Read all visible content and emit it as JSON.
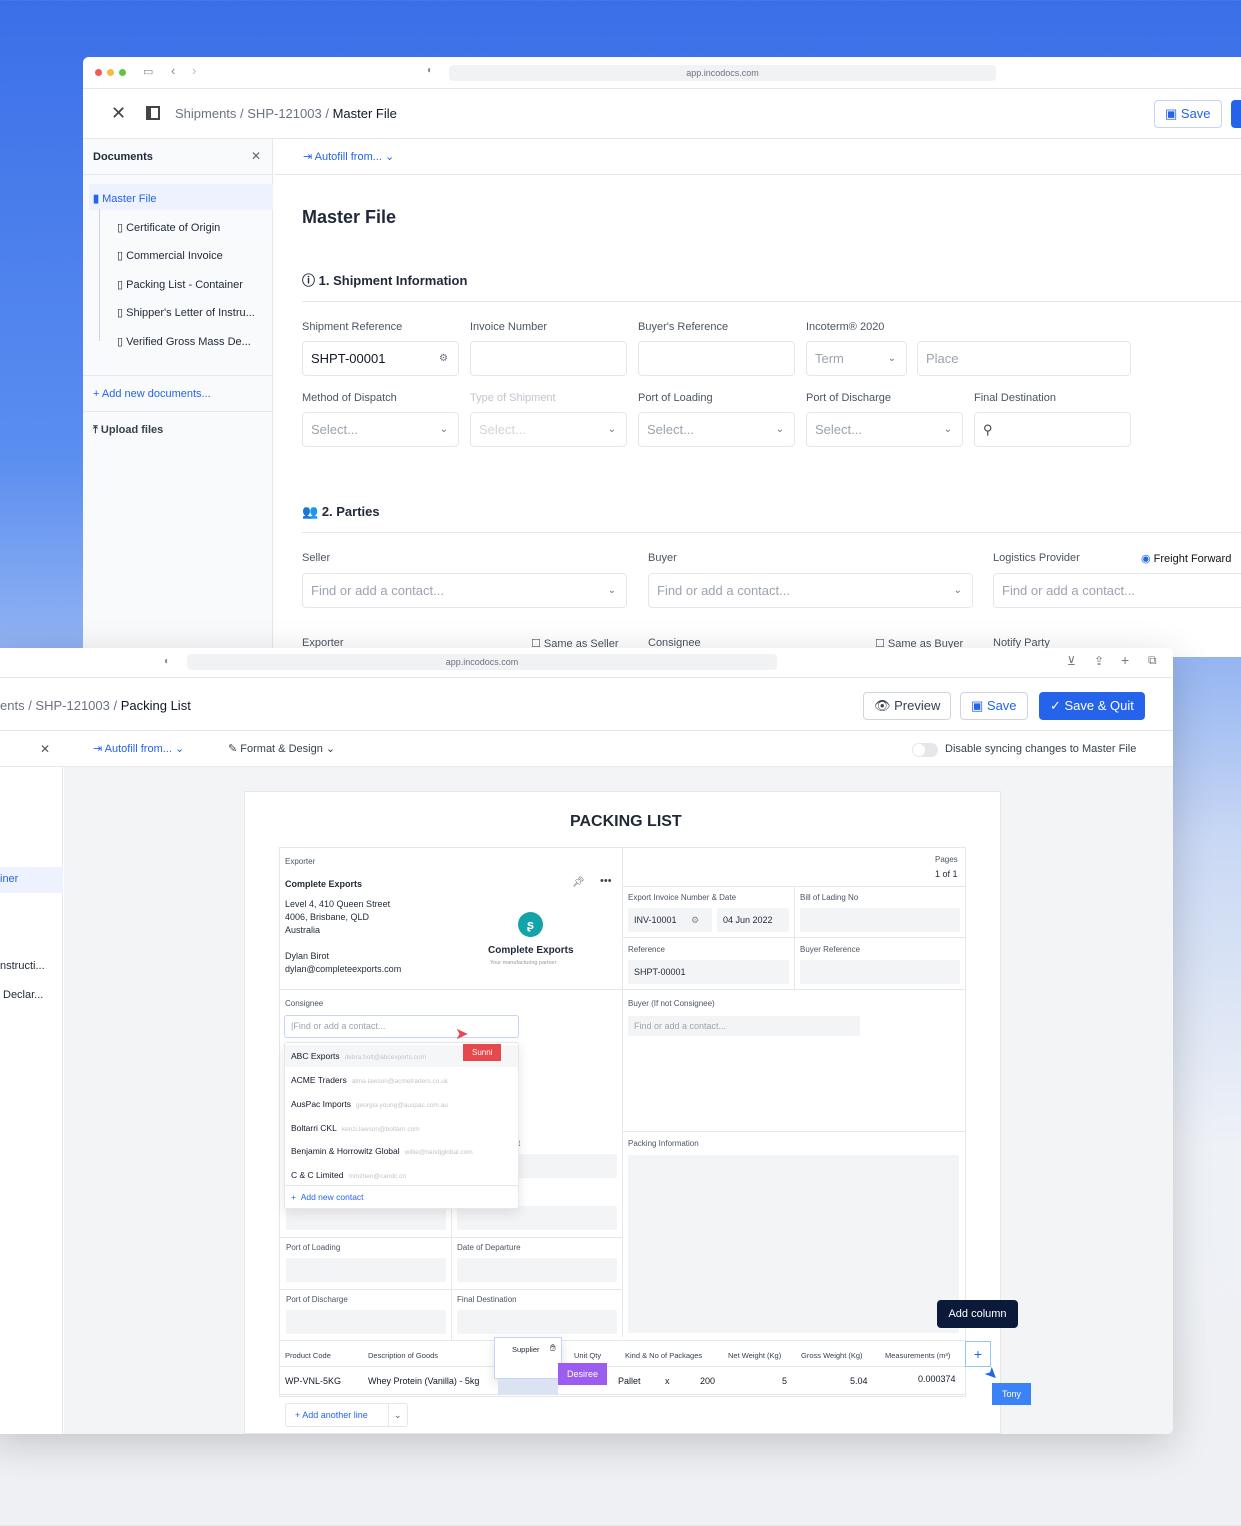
{
  "back_window": {
    "url": "app.incodocs.com",
    "breadcrumb": [
      "Shipments",
      "SHP-121003",
      "Master File"
    ],
    "save_label": "Save",
    "sidebar": {
      "title": "Documents",
      "items": [
        {
          "label": "Master File"
        },
        {
          "label": "Certificate of Origin"
        },
        {
          "label": "Commercial Invoice"
        },
        {
          "label": "Packing List - Container"
        },
        {
          "label": "Shipper's Letter of Instru..."
        },
        {
          "label": "Verified Gross Mass De..."
        }
      ],
      "add_label": "Add new documents...",
      "upload_label": "Upload files"
    },
    "autofill_label": "Autofill from...",
    "page_title": "Master File",
    "section1": "1. Shipment Information",
    "fields": {
      "shipment_reference": {
        "label": "Shipment Reference",
        "value": "SHPT-00001"
      },
      "invoice_number": {
        "label": "Invoice Number"
      },
      "buyers_reference": {
        "label": "Buyer's Reference"
      },
      "incoterm": {
        "label": "Incoterm® 2020",
        "term_placeholder": "Term",
        "place_placeholder": "Place"
      },
      "method_of_dispatch": {
        "label": "Method of Dispatch",
        "placeholder": "Select..."
      },
      "type_of_shipment": {
        "label": "Type of Shipment",
        "placeholder": "Select..."
      },
      "port_of_loading": {
        "label": "Port of Loading",
        "placeholder": "Select..."
      },
      "port_of_discharge": {
        "label": "Port of Discharge",
        "placeholder": "Select..."
      },
      "final_destination": {
        "label": "Final Destination"
      }
    },
    "section2": "2. Parties",
    "parties": {
      "seller": "Seller",
      "buyer": "Buyer",
      "logistics": "Logistics Provider",
      "freight": "Freight Forward",
      "placeholder": "Find or add a contact...",
      "exporter": "Exporter",
      "same_as_seller": "Same as Seller",
      "consignee": "Consignee",
      "same_as_buyer": "Same as Buyer",
      "notify": "Notify Party"
    }
  },
  "front_window": {
    "url": "app.incodocs.com",
    "breadcrumb": [
      "ents",
      "SHP-121003",
      "Packing List"
    ],
    "preview_label": "Preview",
    "save_label": "Save",
    "save_quit_label": "Save & Quit",
    "autofill_label": "Autofill from...",
    "format_label": "Format & Design",
    "sync_label": "Disable syncing changes to Master File",
    "sidebar_fragments": [
      "iner",
      "nstructi...",
      "Declar..."
    ],
    "doc": {
      "title": "PACKING LIST",
      "exporter_label": "Exporter",
      "exporter_name": "Complete Exports",
      "address": [
        "Level 4, 410 Queen Street",
        "4006, Brisbane, QLD",
        "Australia"
      ],
      "contact_name": "Dylan Birot",
      "contact_email": "dylan@completeexports.com",
      "logo_name": "Complete Exports",
      "logo_tagline": "Your manufacturing partner",
      "pages_label": "Pages",
      "pages_value": "1 of 1",
      "invoice_label": "Export Invoice Number & Date",
      "invoice_value": "INV-10001",
      "invoice_date": "04 Jun 2022",
      "bol_label": "Bill of Lading No",
      "reference_label": "Reference",
      "reference_value": "SHPT-00001",
      "buyer_ref_label": "Buyer Reference",
      "consignee_label": "Consignee",
      "consignee_placeholder": "Find or add a contact...",
      "buyer_label": "Buyer (If not Consignee)",
      "buyer_placeholder": "Find or add a contact...",
      "contacts": [
        {
          "name": "ABC Exports",
          "email": "debra.holt@abcexports.com"
        },
        {
          "name": "ACME Traders",
          "email": "alma.lawson@acmetraders.co.uk"
        },
        {
          "name": "AusPac Imports",
          "email": "georgia.young@auspac.com.au"
        },
        {
          "name": "Boltarri CKL",
          "email": "kenzi.lawson@boltarri.com"
        },
        {
          "name": "Benjamin & Horrowitz Global",
          "email": "willie@handjglobal.com"
        },
        {
          "name": "C & C Limited",
          "email": "mmzhen@candc.cn"
        }
      ],
      "add_contact": "Add new contact",
      "hidden_fragment": "t",
      "packing_info_label": "Packing Information",
      "port_loading_label": "Port of Loading",
      "departure_label": "Date of Departure",
      "port_discharge_label": "Port of Discharge",
      "final_dest_label": "Final Destination",
      "table_headers": [
        "Product Code",
        "Description of Goods",
        "Supplier",
        "Unit Qty",
        "Kind & No of Packages",
        "Net Weight (Kg)",
        "Gross Weight (Kg)",
        "Measurements (m³)"
      ],
      "row": {
        "product_code": "WP-VNL-5KG",
        "description": "Whey Protein (Vanilla) - 5kg",
        "kind": "Pallet",
        "x": "x",
        "packages": "200",
        "net": "5",
        "gross": "5.04",
        "measure": "0.000374"
      },
      "add_line": "Add another line",
      "add_column_tooltip": "Add column"
    },
    "cursors": [
      {
        "name": "Sunni",
        "color": "#e5484d"
      },
      {
        "name": "Desiree",
        "color": "#9b5cf0"
      },
      {
        "name": "Tony",
        "color": "#3b82f6"
      }
    ]
  },
  "colors": {
    "accent": "#2563eb",
    "logo": "#14a3a8"
  }
}
